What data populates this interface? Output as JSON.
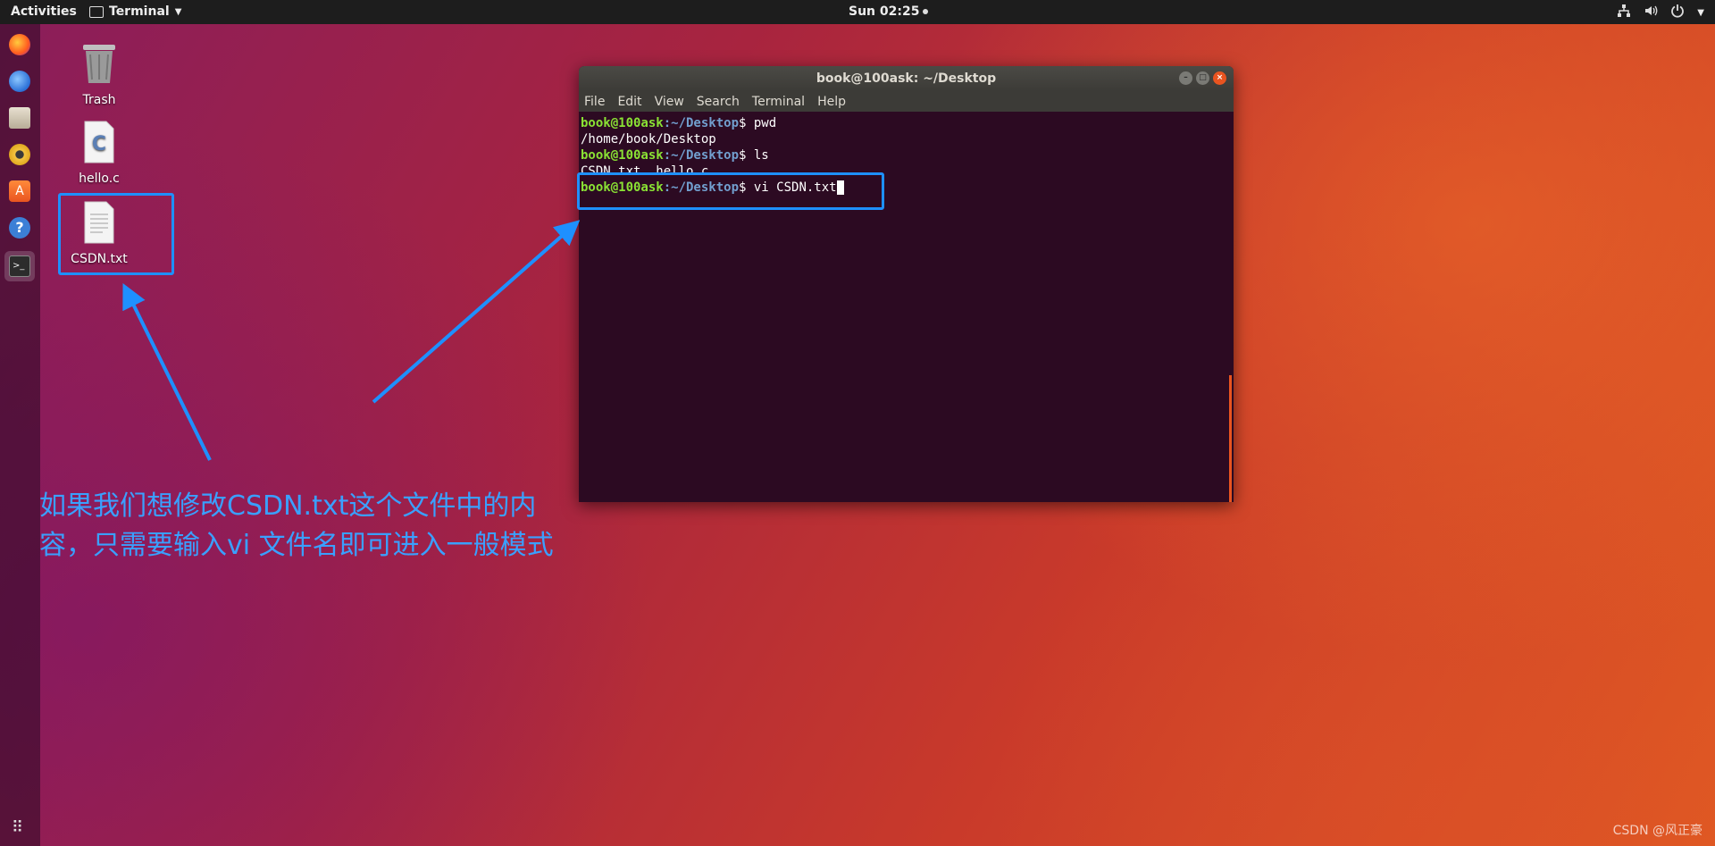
{
  "topbar": {
    "activities": "Activities",
    "app_name": "Terminal",
    "clock": "Sun 02:25"
  },
  "dock": {
    "items": [
      "firefox-icon",
      "thunderbird-icon",
      "files-icon",
      "rhythmbox-icon",
      "software-icon",
      "help-icon",
      "terminal-icon"
    ]
  },
  "desktop": {
    "icons": [
      {
        "label": "Trash",
        "icon": "trash-icon"
      },
      {
        "label": "hello.c",
        "icon": "c-file-icon"
      },
      {
        "label": "CSDN.txt",
        "icon": "text-file-icon"
      }
    ]
  },
  "terminal": {
    "title": "book@100ask: ~/Desktop",
    "menu": [
      "File",
      "Edit",
      "View",
      "Search",
      "Terminal",
      "Help"
    ],
    "prompt_user": "book@100ask",
    "prompt_path": ":~/Desktop",
    "lines": [
      {
        "cmd": "$ pwd"
      },
      {
        "out": "/home/book/Desktop"
      },
      {
        "cmd": "$ ls"
      },
      {
        "out": "CSDN.txt  hello.c"
      },
      {
        "cmd": "$ vi CSDN.txt"
      }
    ]
  },
  "annotation": {
    "text": "如果我们想修改CSDN.txt这个文件中的内容，只需要输入vi 文件名即可进入一般模式"
  },
  "watermark": "CSDN @风正豪",
  "colors": {
    "highlight": "#1e90ff",
    "accent": "#e95420"
  }
}
